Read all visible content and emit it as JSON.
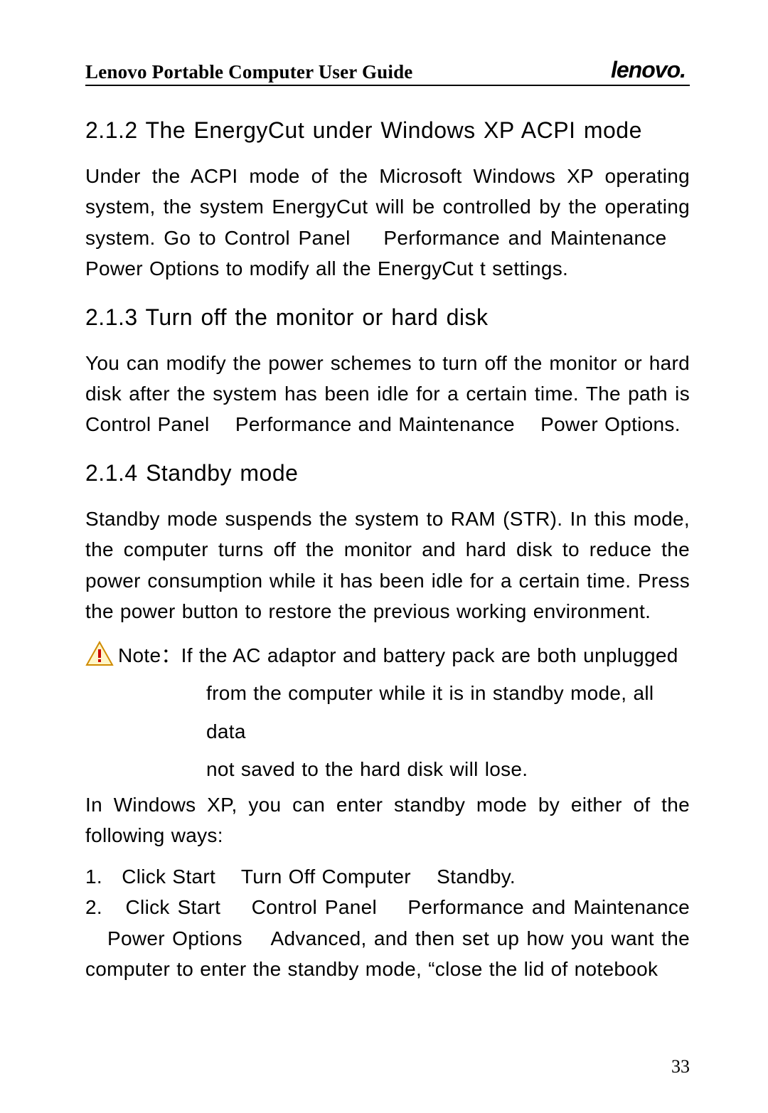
{
  "header": {
    "title": "Lenovo Portable Computer User Guide",
    "brand": "lenovo."
  },
  "sections": {
    "s1": {
      "heading": "2.1.2  The EnergyCut under Windows XP ACPI mode",
      "body": "Under the ACPI mode of the Microsoft Windows XP operating system, the system EnergyCut will be controlled by the operating system. Go to Control Panel    Performance and Maintenance    Power Options to modify all the EnergyCut t settings."
    },
    "s2": {
      "heading": "2.1.3  Turn off the monitor or hard disk",
      "body": "You can modify the power schemes to turn off the monitor or hard disk after the system has been idle for a certain time. The path is Control Panel    Performance and Maintenance    Power Options."
    },
    "s3": {
      "heading": "2.1.4  Standby mode",
      "body": "Standby mode suspends the system to RAM (STR). In this mode, the computer turns off the monitor and hard disk to reduce the power consumption while it has been idle for a certain time. Press the power button to restore the previous working environment.",
      "note1": "Note：If the AC adaptor and battery pack are both unplugged",
      "note2": "from the computer while it is in standby mode, all data",
      "note3": "not saved to the hard disk will lose.",
      "intro": "In Windows XP, you can enter standby mode by either of the following ways:",
      "item1": "1.   Click Start    Turn Off Computer    Standby.",
      "item2": "2.   Click Start    Control Panel    Performance and Maintenance    Power Options    Advanced, and then set up how you want the computer to enter the standby mode, “close the lid of notebook"
    }
  },
  "page_number": "33"
}
